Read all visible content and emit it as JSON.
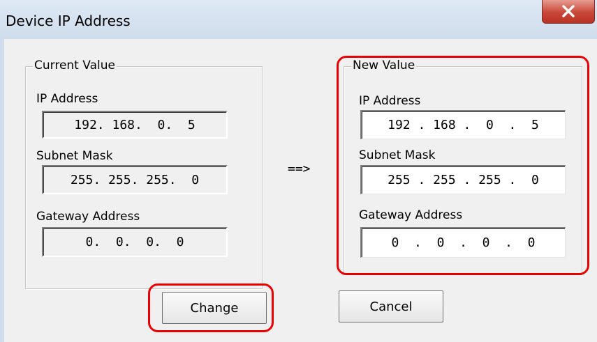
{
  "window": {
    "title": "Device IP Address",
    "close_icon": "close-icon"
  },
  "current": {
    "legend": "Current Value",
    "ip_label": "IP Address",
    "ip_value": "192. 168.  0.  5",
    "subnet_label": "Subnet Mask",
    "subnet_value": "255. 255. 255.  0",
    "gateway_label": "Gateway Address",
    "gateway_value": "0.  0.  0.  0"
  },
  "arrow": "==>",
  "new": {
    "legend": "New Value",
    "ip_label": "IP Address",
    "ip_value": "192 . 168 .  0  .  5",
    "subnet_label": "Subnet Mask",
    "subnet_value": "255 . 255 . 255 .  0",
    "gateway_label": "Gateway Address",
    "gateway_value": "0  .  0  .  0  .  0"
  },
  "buttons": {
    "change": "Change",
    "cancel": "Cancel"
  },
  "colors": {
    "highlight": "#e60000",
    "close_button": "#c9483a"
  }
}
